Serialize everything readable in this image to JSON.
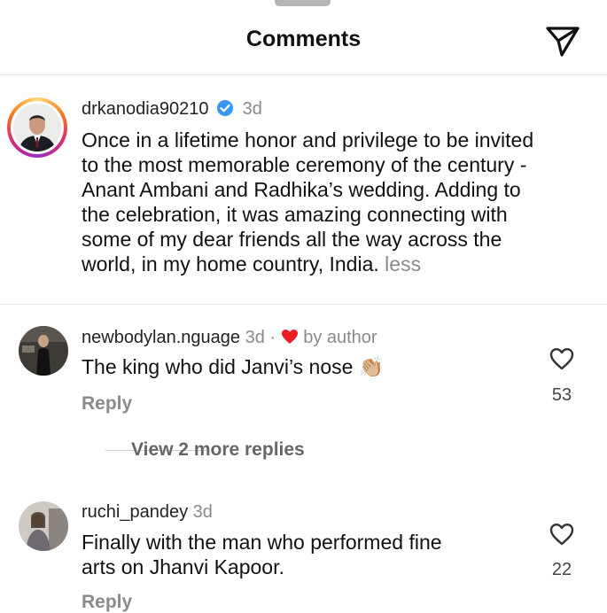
{
  "header": {
    "title": "Comments"
  },
  "caption": {
    "username": "drkanodia90210",
    "time": "3d",
    "lines": [
      "Once in a lifetime honor and privilege to be invited",
      "to the most memorable ceremony of the century -",
      "Anant Ambani and Radhika’s wedding. Adding to",
      "the celebration, it was amazing connecting with",
      "some of my dear friends all the way across the",
      "world, in my home country, India."
    ],
    "less_label": "less"
  },
  "comments": [
    {
      "username": "newbodylan.nguage",
      "meta": "3d ·",
      "author_label": "by author",
      "text": "The king who did Janvi’s nose 👏🏼",
      "reply_label": "Reply",
      "likes": "53"
    },
    {
      "username": "ruchi_pandey",
      "meta": "3d",
      "lines": [
        "Finally with the man who performed fine",
        "arts on Jhanvi Kapoor."
      ],
      "reply_label": "Reply",
      "likes": "22"
    }
  ],
  "view_replies_label": "View 2 more replies",
  "colors": {
    "verified": "#3897f0",
    "heart_red": "#ed1c24",
    "muted": "#8a8a8a"
  }
}
